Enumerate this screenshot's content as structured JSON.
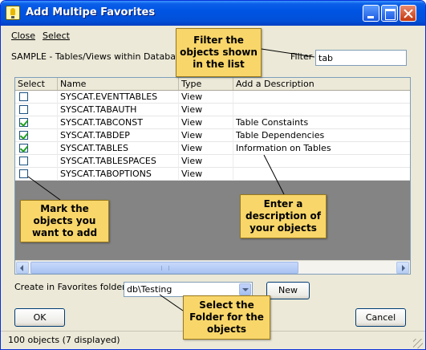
{
  "window": {
    "title": "Add Multipe Favorites",
    "app_icon": "lightbulb-icon"
  },
  "menu": {
    "close_label": "Close",
    "select_label": "Select"
  },
  "toolbar": {
    "source_label": "SAMPLE - Tables/Views within Database",
    "filter_label": "Filter",
    "filter_value": "tab"
  },
  "grid": {
    "columns": [
      "Select",
      "Name",
      "Type",
      "Add a Description"
    ],
    "rows": [
      {
        "checked": false,
        "name": "SYSCAT.EVENTTABLES",
        "type": "View",
        "description": ""
      },
      {
        "checked": false,
        "name": "SYSCAT.TABAUTH",
        "type": "View",
        "description": ""
      },
      {
        "checked": true,
        "name": "SYSCAT.TABCONST",
        "type": "View",
        "description": "Table Constaints"
      },
      {
        "checked": true,
        "name": "SYSCAT.TABDEP",
        "type": "View",
        "description": "Table Dependencies"
      },
      {
        "checked": true,
        "name": "SYSCAT.TABLES",
        "type": "View",
        "description": "Information on Tables"
      },
      {
        "checked": false,
        "name": "SYSCAT.TABLESPACES",
        "type": "View",
        "description": ""
      },
      {
        "checked": false,
        "name": "SYSCAT.TABOPTIONS",
        "type": "View",
        "description": ""
      }
    ]
  },
  "folder": {
    "label": "Create in Favorites folder",
    "value": "db\\Testing",
    "new_button": "New"
  },
  "buttons": {
    "ok": "OK",
    "cancel": "Cancel"
  },
  "status": {
    "text": "100 objects (7 displayed)"
  },
  "callouts": {
    "filter": "Filter the\nobjects shown\nin the list",
    "mark": "Mark the\nobjects you\nwant to add",
    "description": "Enter a\ndescription of\nyour objects",
    "folder": "Select the\nFolder for the\nobjects"
  },
  "colors": {
    "titlebar": "#0054e3",
    "window_bg": "#ece9d8",
    "callout_bg": "#f8d66a",
    "grid_empty_bg": "#848484"
  }
}
